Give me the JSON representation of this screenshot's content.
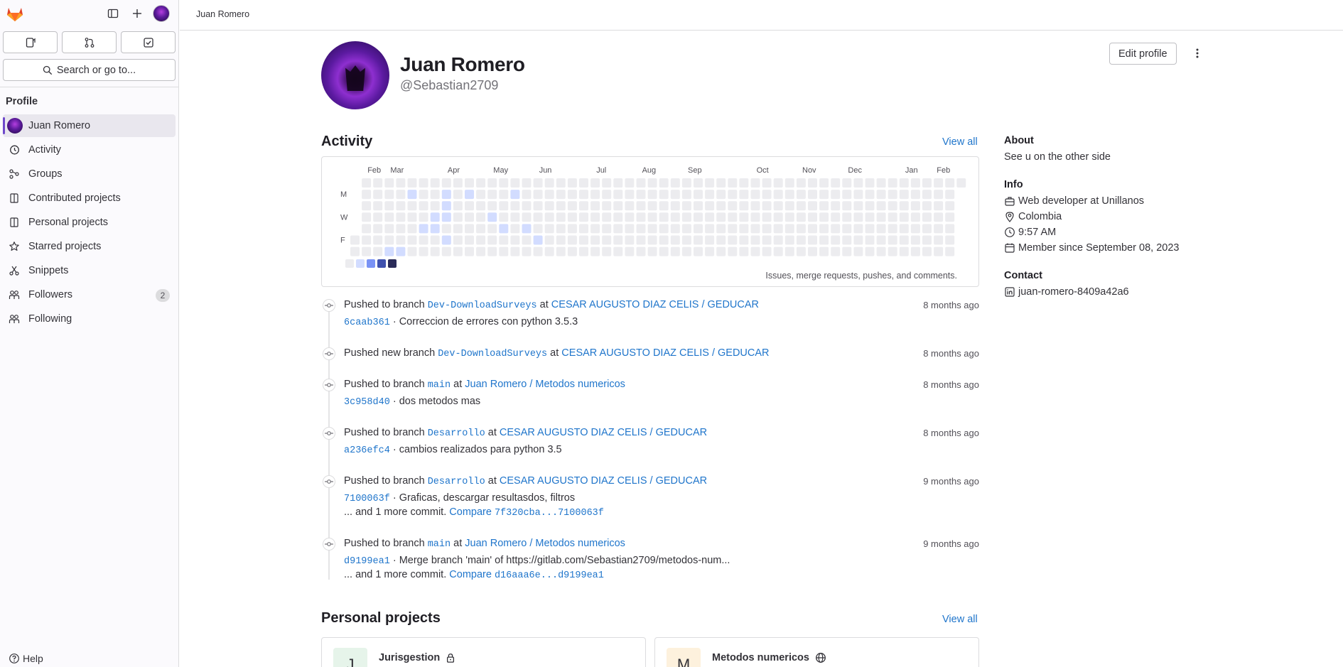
{
  "sidebar": {
    "search_label": "Search or go to...",
    "section_heading": "Profile",
    "items": [
      {
        "label": "Juan Romero"
      },
      {
        "label": "Activity"
      },
      {
        "label": "Groups"
      },
      {
        "label": "Contributed projects"
      },
      {
        "label": "Personal projects"
      },
      {
        "label": "Starred projects"
      },
      {
        "label": "Snippets"
      },
      {
        "label": "Followers",
        "badge": "2"
      },
      {
        "label": "Following"
      }
    ],
    "help_label": "Help"
  },
  "topbar": {
    "breadcrumb": "Juan Romero"
  },
  "profile": {
    "name": "Juan Romero",
    "username": "@Sebastian2709",
    "edit_label": "Edit profile"
  },
  "activity": {
    "title": "Activity",
    "view_all": "View all",
    "calendar": {
      "months": [
        "Feb",
        "Mar",
        "Apr",
        "May",
        "Jun",
        "Jul",
        "Aug",
        "Sep",
        "Oct",
        "Nov",
        "Dec",
        "Jan",
        "Feb"
      ],
      "day_labels": [
        "M",
        "W",
        "F"
      ],
      "note": "Issues, merge requests, pushes, and comments.",
      "colors": [
        "#ececef",
        "#d2dcff",
        "#7992f5",
        "#3f51ae",
        "#2a2b59"
      ]
    },
    "events": [
      {
        "action": "Pushed to branch",
        "branch": "Dev-DownloadSurveys",
        "at": "at",
        "project": "CESAR AUGUSTO DIAZ CELIS / GEDUCAR",
        "time": "8 months ago",
        "sha": "6caab361",
        "message": "· Correccion de errores con python 3.5.3"
      },
      {
        "action": "Pushed new branch",
        "branch": "Dev-DownloadSurveys",
        "at": "at",
        "project": "CESAR AUGUSTO DIAZ CELIS / GEDUCAR",
        "time": "8 months ago"
      },
      {
        "action": "Pushed to branch",
        "branch": "main",
        "at": "at",
        "project": "Juan Romero / Metodos numericos",
        "time": "8 months ago",
        "sha": "3c958d40",
        "message": "· dos metodos mas"
      },
      {
        "action": "Pushed to branch",
        "branch": "Desarrollo",
        "at": "at",
        "project": "CESAR AUGUSTO DIAZ CELIS / GEDUCAR",
        "time": "8 months ago",
        "sha": "a236efc4",
        "message": "· cambios realizados para python 3.5"
      },
      {
        "action": "Pushed to branch",
        "branch": "Desarrollo",
        "at": "at",
        "project": "CESAR AUGUSTO DIAZ CELIS / GEDUCAR",
        "time": "9 months ago",
        "sha": "7100063f",
        "message": "· Graficas, descargar resultasdos, filtros",
        "more": "... and 1 more commit.",
        "compare_label": "Compare",
        "compare": "7f320cba...7100063f"
      },
      {
        "action": "Pushed to branch",
        "branch": "main",
        "at": "at",
        "project": "Juan Romero / Metodos numericos",
        "time": "9 months ago",
        "sha": "d9199ea1",
        "message": "· Merge branch 'main' of https://gitlab.com/Sebastian2709/metodos-num...",
        "more": "... and 1 more commit.",
        "compare_label": "Compare",
        "compare": "d16aaa6e...d9199ea1"
      }
    ]
  },
  "personal_projects": {
    "title": "Personal projects",
    "view_all": "View all",
    "items": [
      {
        "initial": "J",
        "name": "Jurisgestion",
        "visibility_icon": "lock-icon",
        "avatar_color": "#e6f4ea"
      },
      {
        "initial": "M",
        "name": "Metodos numericos",
        "visibility_icon": "globe-icon",
        "avatar_color": "#fdf1dd"
      }
    ]
  },
  "about": {
    "about_heading": "About",
    "bio": "See u on the other side",
    "info_heading": "Info",
    "job": "Web developer at Unillanos",
    "location": "Colombia",
    "local_time": "9:57 AM",
    "member_since": "Member since September 08, 2023",
    "contact_heading": "Contact",
    "linkedin": "juan-romero-8409a42a6"
  }
}
